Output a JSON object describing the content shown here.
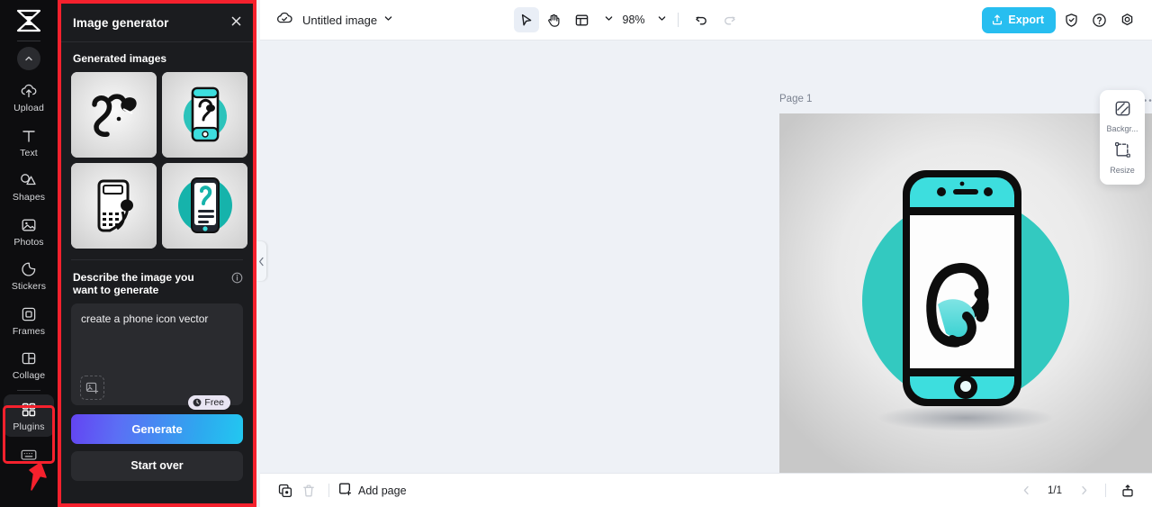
{
  "app": {
    "logo_name": "capcut-logo"
  },
  "sidebar": {
    "collapse_icon": "chevron-up-icon",
    "items": [
      {
        "label": "Upload",
        "icon": "upload-cloud-icon",
        "active": false
      },
      {
        "label": "Text",
        "icon": "text-icon",
        "active": false
      },
      {
        "label": "Shapes",
        "icon": "shapes-icon",
        "active": false
      },
      {
        "label": "Photos",
        "icon": "photos-icon",
        "active": false
      },
      {
        "label": "Stickers",
        "icon": "stickers-icon",
        "active": false
      },
      {
        "label": "Frames",
        "icon": "frames-icon",
        "active": false
      },
      {
        "label": "Collage",
        "icon": "collage-icon",
        "active": false
      },
      {
        "label": "Plugins",
        "icon": "plugins-grid-icon",
        "active": true
      }
    ],
    "keyboard_icon": "keyboard-icon",
    "highlight_color": "#f5212d"
  },
  "panel": {
    "title": "Image generator",
    "close_icon": "close-icon",
    "generated_section_title": "Generated images",
    "thumbnails": [
      {
        "name": "generated-image-1",
        "alt": "abstract black phone handset icon"
      },
      {
        "name": "generated-image-2",
        "alt": "teal phone with headset on screen"
      },
      {
        "name": "generated-image-3",
        "alt": "black smartphone with keypad outline"
      },
      {
        "name": "generated-image-4",
        "alt": "dark phone on teal circle"
      }
    ],
    "prompt_label": "Describe the image you want to generate",
    "info_icon": "info-icon",
    "prompt_value": "create a phone icon vector",
    "prompt_placeholder": "Describe the image you want to generate",
    "attach_icon": "add-image-icon",
    "generate_label": "Generate",
    "free_badge": "Free",
    "free_badge_icon": "clock-icon",
    "start_over_label": "Start over",
    "collapse_handle_icon": "chevron-left-icon",
    "accent_gradient_from": "#6344f2",
    "accent_gradient_to": "#22c8f0"
  },
  "topbar": {
    "cloud_icon": "cloud-saved-icon",
    "doc_title": "Untitled image",
    "doc_chevron": "chevron-down-icon",
    "tools": [
      {
        "name": "select-tool",
        "icon": "cursor-arrow-icon",
        "selected": true
      },
      {
        "name": "hand-tool",
        "icon": "hand-icon",
        "selected": false
      },
      {
        "name": "layout-tool",
        "icon": "layout-grid-icon",
        "selected": false
      }
    ],
    "layout_chevron": "chevron-down-icon",
    "zoom_value": "98%",
    "zoom_chevron": "chevron-down-icon",
    "undo_icon": "undo-icon",
    "redo_icon": "redo-icon",
    "export_label": "Export",
    "export_icon": "upload-box-icon",
    "export_color": "#27bef0",
    "right_icons": [
      {
        "name": "shield-check-icon"
      },
      {
        "name": "help-question-icon"
      },
      {
        "name": "settings-gear-icon"
      }
    ]
  },
  "canvas": {
    "page_label": "Page 1",
    "duplicate_icon": "duplicate-page-icon",
    "more_icon": "more-dots-icon",
    "artwork_alt": "teal phone icon vector on light gradient background",
    "artwork_accent": "#3ddede",
    "artwork_circle": "#33c9c0"
  },
  "float_panel": {
    "items": [
      {
        "label": "Backgr...",
        "icon": "background-icon"
      },
      {
        "label": "Resize",
        "icon": "resize-icon"
      }
    ]
  },
  "bottombar": {
    "duplicate_icon": "duplicate-icon",
    "delete_icon": "trash-icon",
    "add_page_label": "Add page",
    "add_page_icon": "add-page-icon",
    "prev_icon": "chevron-left-icon",
    "page_indicator": "1/1",
    "next_icon": "chevron-right-icon",
    "export_icon": "export-tray-icon"
  }
}
